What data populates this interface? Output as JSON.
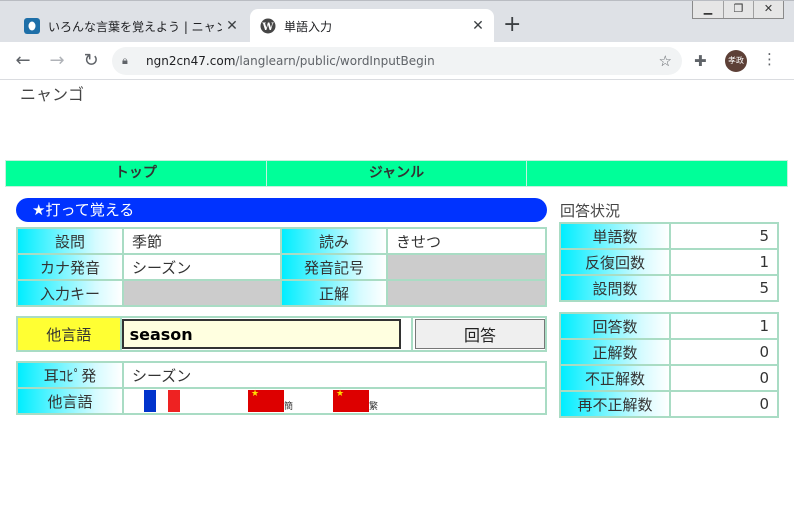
{
  "browser": {
    "tabs": [
      {
        "title": "いろんな言葉を覚えよう | ニャン語",
        "active": false
      },
      {
        "title": "単語入力",
        "active": true
      }
    ],
    "url_host": "ngn2cn47.com",
    "url_path": "/langlearn/public/wordInputBegin",
    "avatar_text": "孝政"
  },
  "site_title": "ニャンゴ",
  "menu": [
    "トップ",
    "ジャンル",
    ""
  ],
  "mode_title": "★打って覚える",
  "question": {
    "labels": {
      "question": "設問",
      "reading": "読み",
      "kana": "カナ発音",
      "phonetic": "発音記号",
      "input_key": "入力キー",
      "correct": "正解"
    },
    "question": "季節",
    "reading": "きせつ",
    "kana": "シーズン",
    "phonetic": "",
    "input_key": "",
    "correct": ""
  },
  "answer": {
    "label": "他言語",
    "value": "season",
    "button": "回答"
  },
  "info": {
    "ear_label": "耳ｺﾋﾟ発",
    "ear_value": "シーズン",
    "other_label": "他言語",
    "flags": [
      {
        "icon": "france-flag-icon",
        "text": ""
      },
      {
        "icon": "china-flag-icon",
        "text": "簡"
      },
      {
        "icon": "china-flag-icon",
        "text": "繁"
      }
    ]
  },
  "status": {
    "title": "回答状況",
    "group1": [
      {
        "label": "単語数",
        "value": "5"
      },
      {
        "label": "反復回数",
        "value": "1"
      },
      {
        "label": "設問数",
        "value": "5"
      }
    ],
    "group2": [
      {
        "label": "回答数",
        "value": "1"
      },
      {
        "label": "正解数",
        "value": "0"
      },
      {
        "label": "不正解数",
        "value": "0"
      },
      {
        "label": "再不正解数",
        "value": "0"
      }
    ]
  },
  "colors": {
    "menu_green": "#00ff99",
    "pill_blue": "#0033ff",
    "label_cyan": "#00eeff",
    "answer_yellow": "#ffff33"
  }
}
